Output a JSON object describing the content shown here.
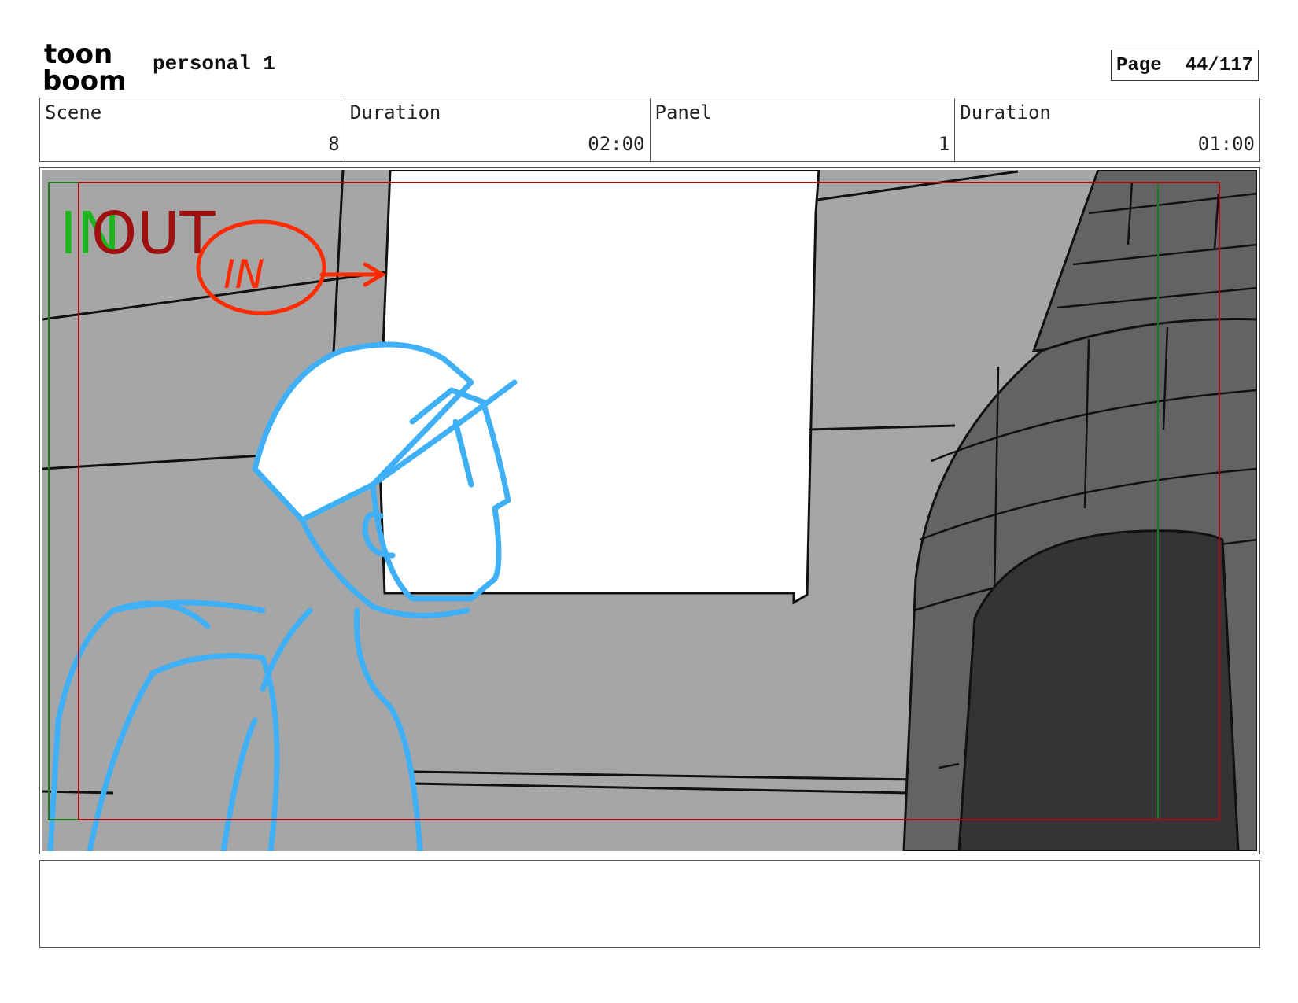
{
  "header": {
    "logo": {
      "line1": "toon",
      "line2": "boom"
    },
    "project_title": "personal 1",
    "page_label": "Page",
    "page_number": "44/117"
  },
  "info": {
    "scene_label": "Scene",
    "scene_value": "8",
    "scene_duration_label": "Duration",
    "scene_duration_value": "02:00",
    "panel_label": "Panel",
    "panel_value": "1",
    "panel_duration_label": "Duration",
    "panel_duration_value": "01:00"
  },
  "panel": {
    "in_marker": "IN",
    "out_marker": "OUT",
    "annotation": "IN",
    "colors": {
      "in_marker": "#1fb51f",
      "out_marker": "#a01010",
      "annotation": "#ff2a00",
      "sketch": "#3fb0f5",
      "wall": "#a6a6a6",
      "tower": "#636363",
      "doorway": "#343434"
    }
  },
  "notes": {
    "text": ""
  }
}
